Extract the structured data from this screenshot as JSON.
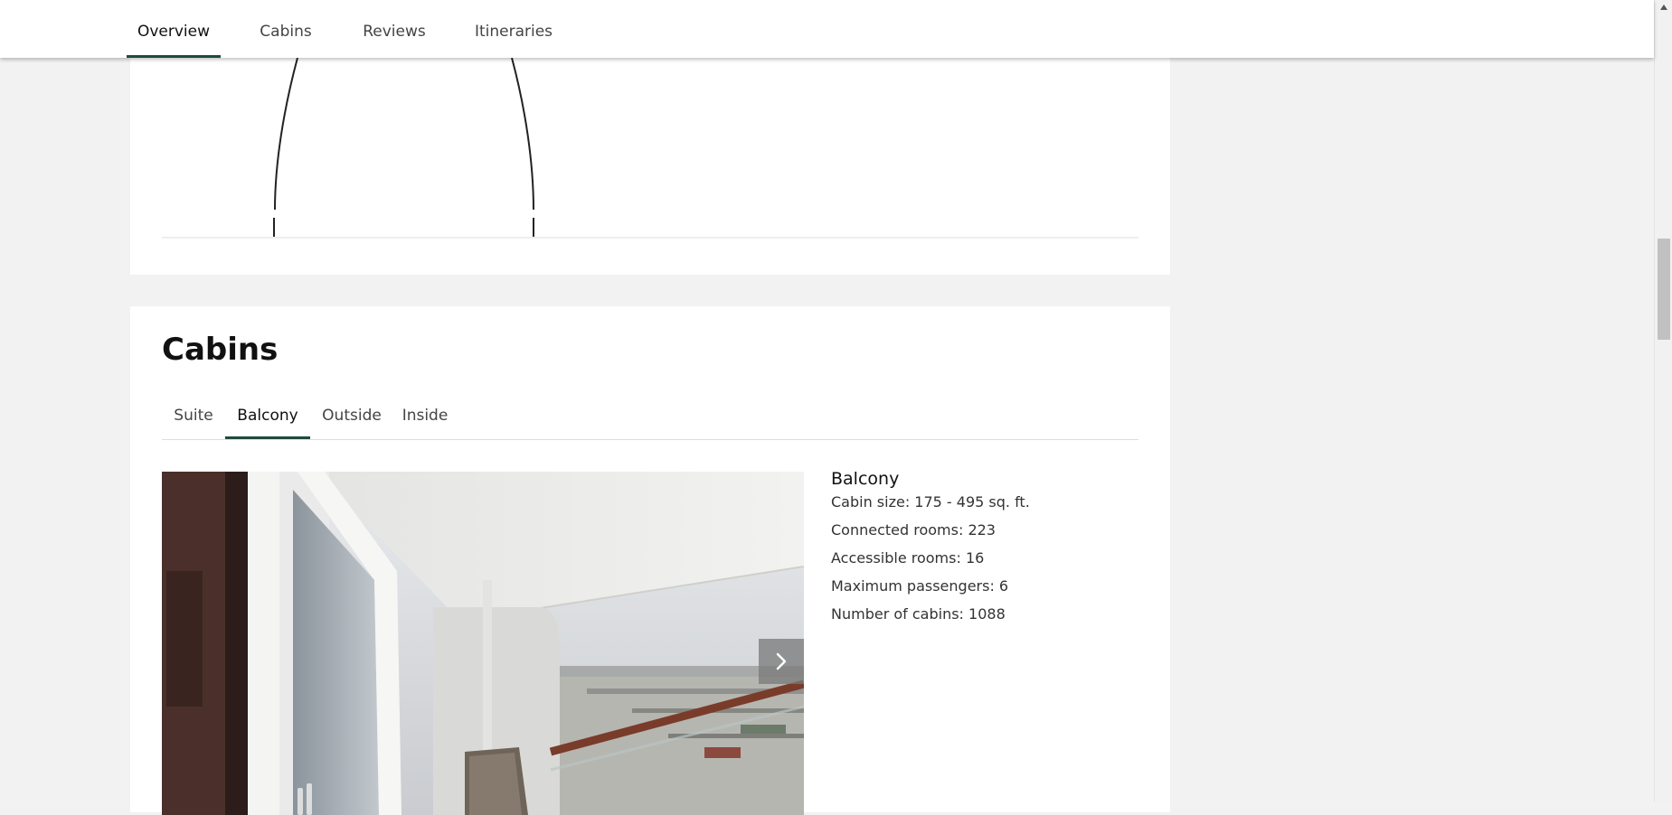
{
  "nav": {
    "tabs": [
      {
        "label": "Overview",
        "active": true
      },
      {
        "label": "Cabins",
        "active": false
      },
      {
        "label": "Reviews",
        "active": false
      },
      {
        "label": "Itineraries",
        "active": false
      }
    ]
  },
  "cabins": {
    "title": "Cabins",
    "tabs": [
      {
        "label": "Suite",
        "active": false
      },
      {
        "label": "Balcony",
        "active": true
      },
      {
        "label": "Outside",
        "active": false
      },
      {
        "label": "Inside",
        "active": false
      }
    ],
    "selected": {
      "name": "Balcony",
      "details": [
        "Cabin size: 175 - 495 sq. ft.",
        "Connected rooms: 223",
        "Accessible rooms: 16",
        "Maximum passengers: 6",
        "Number of cabins: 1088"
      ]
    },
    "next_icon": "chevron-right-icon"
  },
  "colors": {
    "accent": "#1f4b3b",
    "background": "#f2f2f2"
  }
}
